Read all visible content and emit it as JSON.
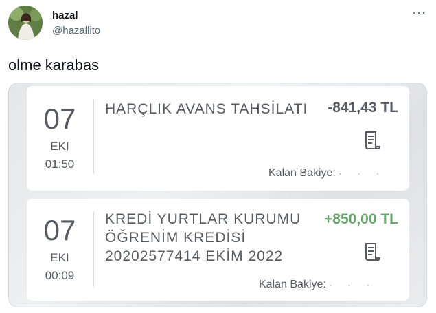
{
  "author": {
    "name": "hazal",
    "handle": "@hazallito",
    "more_icon": "more-dots-icon"
  },
  "tweet": {
    "text": "olme karabas"
  },
  "transactions": [
    {
      "day": "07",
      "month": "EKI",
      "time": "01:50",
      "title_lines": [
        "HARÇLIK AVANS TAHSİLATI"
      ],
      "amount": "-841,43 TL",
      "balance_label": "Kalan Bakiye:",
      "balance_value": "· · ·",
      "receipt_icon": "receipt-icon"
    },
    {
      "day": "07",
      "month": "EKI",
      "time": "00:09",
      "title_lines": [
        "KREDİ YURTLAR KURUMU",
        "ÖĞRENİM KREDİSİ",
        "20202577414 EKİM 2022"
      ],
      "amount": "+850,00 TL",
      "balance_label": "Kalan Bakiye:",
      "balance_value": "· · ·",
      "receipt_icon": "receipt-icon"
    }
  ],
  "colors": {
    "positive": "#6aa56b",
    "negative": "#555b61"
  }
}
